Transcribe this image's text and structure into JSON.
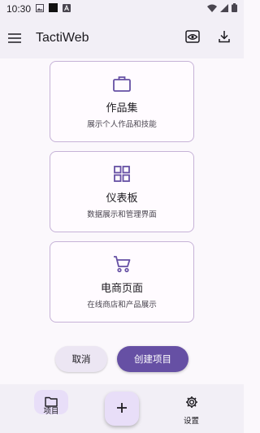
{
  "status_bar": {
    "time": "10:30",
    "icons": [
      "image-icon",
      "square-icon",
      "a-icon",
      "wifi-icon",
      "signal-icon",
      "battery-icon"
    ]
  },
  "app_bar": {
    "title": "TactiWeb",
    "icons": [
      "menu-icon",
      "preview-icon",
      "download-icon"
    ]
  },
  "templates": [
    {
      "icon": "briefcase-icon",
      "title": "作品集",
      "description": "展示个人作品和技能"
    },
    {
      "icon": "dashboard-icon",
      "title": "仪表板",
      "description": "数据展示和管理界面"
    },
    {
      "icon": "cart-icon",
      "title": "电商页面",
      "description": "在线商店和产品展示"
    }
  ],
  "actions": {
    "cancel_label": "取消",
    "create_label": "创建项目"
  },
  "bottom_nav": {
    "items": [
      {
        "label": "项目",
        "icon": "folder-icon",
        "active": true
      },
      {
        "label": "设置",
        "icon": "gear-icon",
        "active": false
      }
    ],
    "fab_icon": "plus-icon"
  },
  "colors": {
    "primary": "#6650a4",
    "surface": "#fbf8fc",
    "bar": "#f2eff6",
    "card_border": "#c6b2d7",
    "tonal": "#e8def8"
  }
}
